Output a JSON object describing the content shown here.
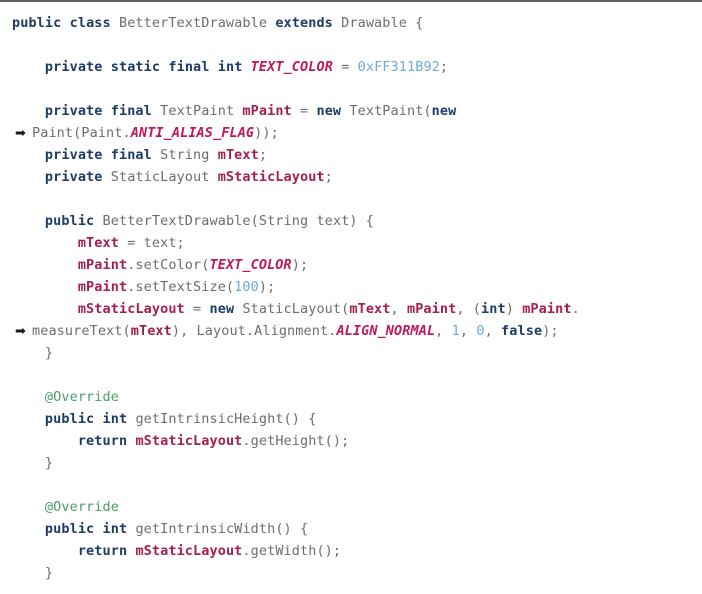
{
  "document": {
    "kind": "source-code-listing",
    "language": "Java",
    "class_name": "BetterTextDrawable",
    "wrap_arrow_glyph": "➡",
    "top_rule_color": "#636363"
  },
  "theme": {
    "background": "#ffffff",
    "plain_text": "#6d6d6d",
    "keyword": "#1f3a66",
    "member_variable": "#a61e4d",
    "constant": "#c2185b",
    "number_literal": "#6fa8dc",
    "annotation": "#4a9e6a",
    "punctuation": "#6d6d6d"
  },
  "code": {
    "lines": [
      {
        "id": "line-1",
        "wrapped": false,
        "indent": 0,
        "tokens": [
          {
            "t": "public",
            "c": "kw"
          },
          {
            "t": " ",
            "c": "plain"
          },
          {
            "t": "class",
            "c": "kw"
          },
          {
            "t": " BetterTextDrawable ",
            "c": "plain"
          },
          {
            "t": "extends",
            "c": "kw"
          },
          {
            "t": " Drawable {",
            "c": "plain"
          }
        ]
      },
      {
        "id": "line-2",
        "wrapped": false,
        "blank": true,
        "tokens": []
      },
      {
        "id": "line-3",
        "wrapped": false,
        "indent": 1,
        "tokens": [
          {
            "t": "private",
            "c": "kw"
          },
          {
            "t": " ",
            "c": "plain"
          },
          {
            "t": "static",
            "c": "kw"
          },
          {
            "t": " ",
            "c": "plain"
          },
          {
            "t": "final",
            "c": "kw"
          },
          {
            "t": " ",
            "c": "plain"
          },
          {
            "t": "int",
            "c": "kw"
          },
          {
            "t": " ",
            "c": "plain"
          },
          {
            "t": "TEXT_COLOR",
            "c": "const"
          },
          {
            "t": " = ",
            "c": "plain"
          },
          {
            "t": "0xFF311B92",
            "c": "num"
          },
          {
            "t": ";",
            "c": "plain"
          }
        ]
      },
      {
        "id": "line-4",
        "wrapped": false,
        "blank": true,
        "tokens": []
      },
      {
        "id": "line-5",
        "wrapped": false,
        "indent": 1,
        "tokens": [
          {
            "t": "private",
            "c": "kw"
          },
          {
            "t": " ",
            "c": "plain"
          },
          {
            "t": "final",
            "c": "kw"
          },
          {
            "t": " TextPaint ",
            "c": "plain"
          },
          {
            "t": "mPaint",
            "c": "member"
          },
          {
            "t": " = ",
            "c": "plain"
          },
          {
            "t": "new",
            "c": "kw"
          },
          {
            "t": " TextPaint(",
            "c": "plain"
          },
          {
            "t": "new",
            "c": "kw"
          }
        ]
      },
      {
        "id": "line-5-cont",
        "wrapped": true,
        "indent": 0,
        "tokens": [
          {
            "t": "Paint(Paint.",
            "c": "plain"
          },
          {
            "t": "ANTI_ALIAS_FLAG",
            "c": "const"
          },
          {
            "t": "));",
            "c": "plain"
          }
        ]
      },
      {
        "id": "line-6",
        "wrapped": false,
        "indent": 1,
        "tokens": [
          {
            "t": "private",
            "c": "kw"
          },
          {
            "t": " ",
            "c": "plain"
          },
          {
            "t": "final",
            "c": "kw"
          },
          {
            "t": " String ",
            "c": "plain"
          },
          {
            "t": "mText",
            "c": "member"
          },
          {
            "t": ";",
            "c": "plain"
          }
        ]
      },
      {
        "id": "line-7",
        "wrapped": false,
        "indent": 1,
        "tokens": [
          {
            "t": "private",
            "c": "kw"
          },
          {
            "t": " StaticLayout ",
            "c": "plain"
          },
          {
            "t": "mStaticLayout",
            "c": "member"
          },
          {
            "t": ";",
            "c": "plain"
          }
        ]
      },
      {
        "id": "line-8",
        "wrapped": false,
        "blank": true,
        "tokens": []
      },
      {
        "id": "line-9",
        "wrapped": false,
        "indent": 1,
        "tokens": [
          {
            "t": "public",
            "c": "kw"
          },
          {
            "t": " BetterTextDrawable(String text) {",
            "c": "plain"
          }
        ]
      },
      {
        "id": "line-10",
        "wrapped": false,
        "indent": 2,
        "tokens": [
          {
            "t": "mText",
            "c": "member"
          },
          {
            "t": " = text;",
            "c": "plain"
          }
        ]
      },
      {
        "id": "line-11",
        "wrapped": false,
        "indent": 2,
        "tokens": [
          {
            "t": "mPaint",
            "c": "member"
          },
          {
            "t": ".setColor(",
            "c": "plain"
          },
          {
            "t": "TEXT_COLOR",
            "c": "const"
          },
          {
            "t": ");",
            "c": "plain"
          }
        ]
      },
      {
        "id": "line-12",
        "wrapped": false,
        "indent": 2,
        "tokens": [
          {
            "t": "mPaint",
            "c": "member"
          },
          {
            "t": ".setTextSize(",
            "c": "plain"
          },
          {
            "t": "100",
            "c": "num"
          },
          {
            "t": ");",
            "c": "plain"
          }
        ]
      },
      {
        "id": "line-13",
        "wrapped": false,
        "indent": 2,
        "tokens": [
          {
            "t": "mStaticLayout",
            "c": "member"
          },
          {
            "t": " = ",
            "c": "plain"
          },
          {
            "t": "new",
            "c": "kw"
          },
          {
            "t": " StaticLayout(",
            "c": "plain"
          },
          {
            "t": "mText",
            "c": "member"
          },
          {
            "t": ", ",
            "c": "plain"
          },
          {
            "t": "mPaint",
            "c": "member"
          },
          {
            "t": ", (",
            "c": "plain"
          },
          {
            "t": "int",
            "c": "kw"
          },
          {
            "t": ") ",
            "c": "plain"
          },
          {
            "t": "mPaint",
            "c": "member"
          },
          {
            "t": ".",
            "c": "plain"
          }
        ]
      },
      {
        "id": "line-13-cont",
        "wrapped": true,
        "indent": 0,
        "tokens": [
          {
            "t": "measureText(",
            "c": "plain"
          },
          {
            "t": "mText",
            "c": "member"
          },
          {
            "t": "), Layout.Alignment.",
            "c": "plain"
          },
          {
            "t": "ALIGN_NORMAL",
            "c": "const"
          },
          {
            "t": ", ",
            "c": "plain"
          },
          {
            "t": "1",
            "c": "num"
          },
          {
            "t": ", ",
            "c": "plain"
          },
          {
            "t": "0",
            "c": "num"
          },
          {
            "t": ", ",
            "c": "plain"
          },
          {
            "t": "false",
            "c": "kw"
          },
          {
            "t": ");",
            "c": "plain"
          }
        ]
      },
      {
        "id": "line-14",
        "wrapped": false,
        "indent": 1,
        "tokens": [
          {
            "t": "}",
            "c": "plain"
          }
        ]
      },
      {
        "id": "line-15",
        "wrapped": false,
        "blank": true,
        "tokens": []
      },
      {
        "id": "line-16",
        "wrapped": false,
        "indent": 1,
        "tokens": [
          {
            "t": "@Override",
            "c": "anno"
          }
        ]
      },
      {
        "id": "line-17",
        "wrapped": false,
        "indent": 1,
        "tokens": [
          {
            "t": "public",
            "c": "kw"
          },
          {
            "t": " ",
            "c": "plain"
          },
          {
            "t": "int",
            "c": "kw"
          },
          {
            "t": " getIntrinsicHeight() {",
            "c": "plain"
          }
        ]
      },
      {
        "id": "line-18",
        "wrapped": false,
        "indent": 2,
        "tokens": [
          {
            "t": "return",
            "c": "kw"
          },
          {
            "t": " ",
            "c": "plain"
          },
          {
            "t": "mStaticLayout",
            "c": "member"
          },
          {
            "t": ".getHeight();",
            "c": "plain"
          }
        ]
      },
      {
        "id": "line-19",
        "wrapped": false,
        "indent": 1,
        "tokens": [
          {
            "t": "}",
            "c": "plain"
          }
        ]
      },
      {
        "id": "line-20",
        "wrapped": false,
        "blank": true,
        "tokens": []
      },
      {
        "id": "line-21",
        "wrapped": false,
        "indent": 1,
        "tokens": [
          {
            "t": "@Override",
            "c": "anno"
          }
        ]
      },
      {
        "id": "line-22",
        "wrapped": false,
        "indent": 1,
        "tokens": [
          {
            "t": "public",
            "c": "kw"
          },
          {
            "t": " ",
            "c": "plain"
          },
          {
            "t": "int",
            "c": "kw"
          },
          {
            "t": " getIntrinsicWidth() {",
            "c": "plain"
          }
        ]
      },
      {
        "id": "line-23",
        "wrapped": false,
        "indent": 2,
        "tokens": [
          {
            "t": "return",
            "c": "kw"
          },
          {
            "t": " ",
            "c": "plain"
          },
          {
            "t": "mStaticLayout",
            "c": "member"
          },
          {
            "t": ".getWidth();",
            "c": "plain"
          }
        ]
      },
      {
        "id": "line-24",
        "wrapped": false,
        "indent": 1,
        "tokens": [
          {
            "t": "}",
            "c": "plain"
          }
        ]
      }
    ]
  }
}
